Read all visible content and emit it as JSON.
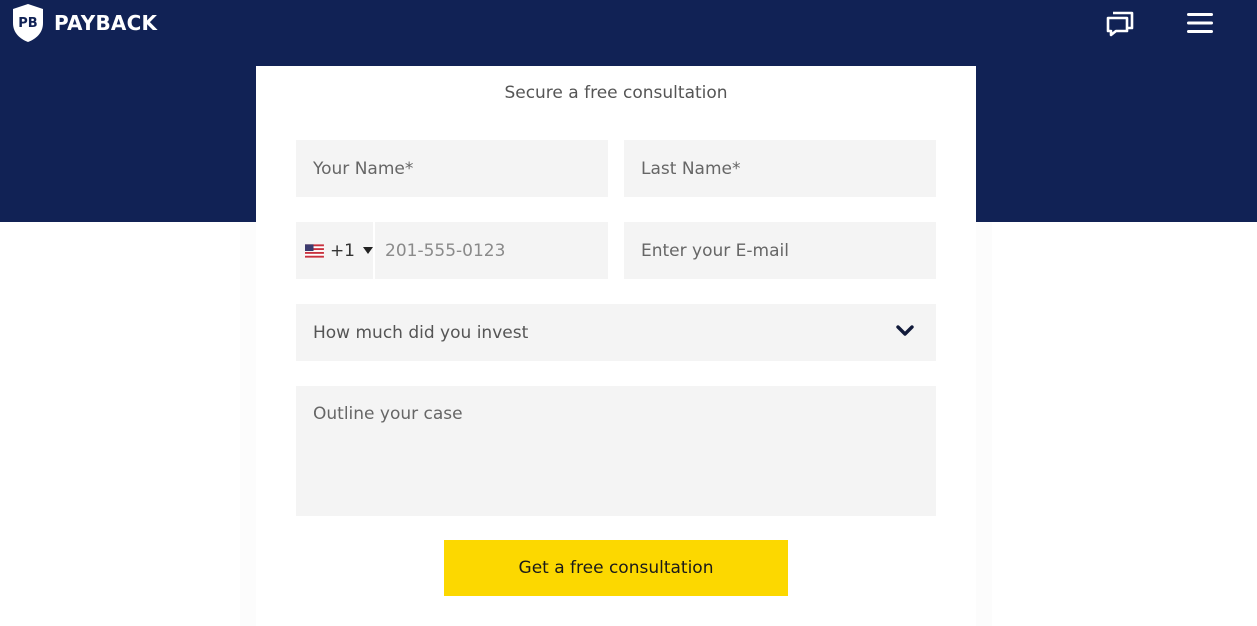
{
  "header": {
    "logo_monogram": "PB",
    "logo_text": "PAYBACK",
    "chat_icon": "chat-bubbles-icon",
    "menu_icon": "hamburger-menu-icon"
  },
  "form": {
    "title": "Secure a free consultation",
    "first_name_placeholder": "Your Name*",
    "last_name_placeholder": "Last Name*",
    "phone": {
      "country_flag": "us-flag-icon",
      "dial_code": "+1",
      "placeholder": "201-555-0123"
    },
    "email_placeholder": "Enter your E-mail",
    "invest_select": "How much did you invest",
    "case_placeholder": "Outline your case",
    "submit_label": "Get a free consultation"
  },
  "colors": {
    "header_bg": "#112255",
    "field_bg": "#f4f4f4",
    "button_bg": "#fcd800"
  }
}
